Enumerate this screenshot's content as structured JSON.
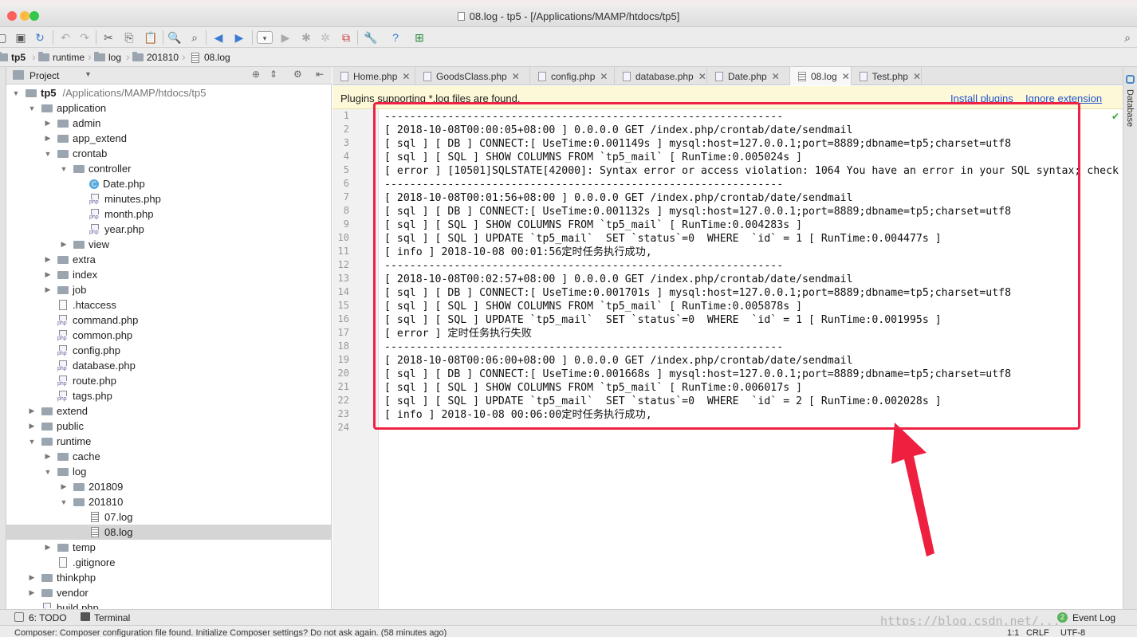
{
  "window": {
    "title": "08.log - tp5 - [/Applications/MAMP/htdocs/tp5]"
  },
  "breadcrumb": [
    "tp5",
    "runtime",
    "log",
    "201810",
    "08.log"
  ],
  "project_panel": {
    "label": "Project",
    "tree": [
      {
        "label": "tp5",
        "path": "/Applications/MAMP/htdocs/tp5",
        "depth": 0,
        "icon": "folder-icon",
        "arrow": "down",
        "bold": true
      },
      {
        "label": "application",
        "depth": 1,
        "icon": "folder-icon",
        "arrow": "down"
      },
      {
        "label": "admin",
        "depth": 2,
        "icon": "folder-icon",
        "arrow": "right"
      },
      {
        "label": "app_extend",
        "depth": 2,
        "icon": "folder-icon",
        "arrow": "right"
      },
      {
        "label": "crontab",
        "depth": 2,
        "icon": "folder-icon",
        "arrow": "down"
      },
      {
        "label": "controller",
        "depth": 3,
        "icon": "folder-icon",
        "arrow": "down"
      },
      {
        "label": "Date.php",
        "depth": 4,
        "icon": "class-icon",
        "arrow": ""
      },
      {
        "label": "minutes.php",
        "depth": 4,
        "icon": "php-file-icon",
        "arrow": ""
      },
      {
        "label": "month.php",
        "depth": 4,
        "icon": "php-file-icon",
        "arrow": ""
      },
      {
        "label": "year.php",
        "depth": 4,
        "icon": "php-file-icon",
        "arrow": ""
      },
      {
        "label": "view",
        "depth": 3,
        "icon": "folder-icon",
        "arrow": "right"
      },
      {
        "label": "extra",
        "depth": 2,
        "icon": "folder-icon",
        "arrow": "right"
      },
      {
        "label": "index",
        "depth": 2,
        "icon": "folder-icon",
        "arrow": "right"
      },
      {
        "label": "job",
        "depth": 2,
        "icon": "folder-icon",
        "arrow": "right"
      },
      {
        "label": ".htaccess",
        "depth": 2,
        "icon": "file-icon",
        "arrow": ""
      },
      {
        "label": "command.php",
        "depth": 2,
        "icon": "php-file-icon",
        "arrow": ""
      },
      {
        "label": "common.php",
        "depth": 2,
        "icon": "php-file-icon",
        "arrow": ""
      },
      {
        "label": "config.php",
        "depth": 2,
        "icon": "php-file-icon",
        "arrow": ""
      },
      {
        "label": "database.php",
        "depth": 2,
        "icon": "php-file-icon",
        "arrow": ""
      },
      {
        "label": "route.php",
        "depth": 2,
        "icon": "php-file-icon",
        "arrow": ""
      },
      {
        "label": "tags.php",
        "depth": 2,
        "icon": "php-file-icon",
        "arrow": ""
      },
      {
        "label": "extend",
        "depth": 1,
        "icon": "folder-icon",
        "arrow": "right"
      },
      {
        "label": "public",
        "depth": 1,
        "icon": "folder-icon",
        "arrow": "right"
      },
      {
        "label": "runtime",
        "depth": 1,
        "icon": "folder-icon",
        "arrow": "down"
      },
      {
        "label": "cache",
        "depth": 2,
        "icon": "folder-icon",
        "arrow": "right"
      },
      {
        "label": "log",
        "depth": 2,
        "icon": "folder-icon",
        "arrow": "down"
      },
      {
        "label": "201809",
        "depth": 3,
        "icon": "folder-icon",
        "arrow": "right"
      },
      {
        "label": "201810",
        "depth": 3,
        "icon": "folder-icon",
        "arrow": "down"
      },
      {
        "label": "07.log",
        "depth": 4,
        "icon": "log-file-icon",
        "arrow": ""
      },
      {
        "label": "08.log",
        "depth": 4,
        "icon": "log-file-icon",
        "arrow": "",
        "selected": true
      },
      {
        "label": "temp",
        "depth": 2,
        "icon": "folder-icon",
        "arrow": "right"
      },
      {
        "label": ".gitignore",
        "depth": 2,
        "icon": "file-icon",
        "arrow": ""
      },
      {
        "label": "thinkphp",
        "depth": 1,
        "icon": "folder-icon",
        "arrow": "right"
      },
      {
        "label": "vendor",
        "depth": 1,
        "icon": "folder-icon",
        "arrow": "right"
      },
      {
        "label": "build.php",
        "depth": 1,
        "icon": "php-file-icon",
        "arrow": ""
      }
    ]
  },
  "editor_tabs": [
    {
      "label": "Home.php",
      "active": false
    },
    {
      "label": "GoodsClass.php",
      "active": false
    },
    {
      "label": "config.php",
      "active": false
    },
    {
      "label": "database.php",
      "active": false
    },
    {
      "label": "Date.php",
      "active": false
    },
    {
      "label": "08.log",
      "active": true
    },
    {
      "label": "Test.php",
      "active": false
    }
  ],
  "banner": {
    "message": "Plugins supporting *.log files are found.",
    "install_link": "Install plugins",
    "ignore_link": "Ignore extension"
  },
  "code_lines": [
    "---------------------------------------------------------------",
    "[ 2018-10-08T00:00:05+08:00 ] 0.0.0.0 GET /index.php/crontab/date/sendmail",
    "[ sql ] [ DB ] CONNECT:[ UseTime:0.001149s ] mysql:host=127.0.0.1;port=8889;dbname=tp5;charset=utf8",
    "[ sql ] [ SQL ] SHOW COLUMNS FROM `tp5_mail` [ RunTime:0.005024s ]",
    "[ error ] [10501]SQLSTATE[42000]: Syntax error or access violation: 1064 You have an error in your SQL syntax; check",
    "---------------------------------------------------------------",
    "[ 2018-10-08T00:01:56+08:00 ] 0.0.0.0 GET /index.php/crontab/date/sendmail",
    "[ sql ] [ DB ] CONNECT:[ UseTime:0.001132s ] mysql:host=127.0.0.1;port=8889;dbname=tp5;charset=utf8",
    "[ sql ] [ SQL ] SHOW COLUMNS FROM `tp5_mail` [ RunTime:0.004283s ]",
    "[ sql ] [ SQL ] UPDATE `tp5_mail`  SET `status`=0  WHERE  `id` = 1 [ RunTime:0.004477s ]",
    "[ info ] 2018-10-08 00:01:56定时任务执行成功,",
    "---------------------------------------------------------------",
    "[ 2018-10-08T00:02:57+08:00 ] 0.0.0.0 GET /index.php/crontab/date/sendmail",
    "[ sql ] [ DB ] CONNECT:[ UseTime:0.001701s ] mysql:host=127.0.0.1;port=8889;dbname=tp5;charset=utf8",
    "[ sql ] [ SQL ] SHOW COLUMNS FROM `tp5_mail` [ RunTime:0.005878s ]",
    "[ sql ] [ SQL ] UPDATE `tp5_mail`  SET `status`=0  WHERE  `id` = 1 [ RunTime:0.001995s ]",
    "[ error ] 定时任务执行失败",
    "---------------------------------------------------------------",
    "[ 2018-10-08T00:06:00+08:00 ] 0.0.0.0 GET /index.php/crontab/date/sendmail",
    "[ sql ] [ DB ] CONNECT:[ UseTime:0.001668s ] mysql:host=127.0.0.1;port=8889;dbname=tp5;charset=utf8",
    "[ sql ] [ SQL ] SHOW COLUMNS FROM `tp5_mail` [ RunTime:0.006017s ]",
    "[ sql ] [ SQL ] UPDATE `tp5_mail`  SET `status`=0  WHERE  `id` = 2 [ RunTime:0.002028s ]",
    "[ info ] 2018-10-08 00:06:00定时任务执行成功,",
    ""
  ],
  "right_panel": {
    "label": "Database"
  },
  "bottom_tools": {
    "todo": "6: TODO",
    "terminal": "Terminal",
    "event_log_count": "2",
    "event_log": "Event Log"
  },
  "status_bar": {
    "message": "Composer: Composer configuration file found. Initialize Composer settings? Do not ask again. (58 minutes ago)",
    "position": "1:1",
    "line_sep": "CRLF",
    "encoding": "UTF-8"
  },
  "watermark": "https://blog.csdn.net/...",
  "colors": {
    "highlight_box": "#ee2244",
    "arrow": "#ee1f3f",
    "link": "#2255cc",
    "banner_bg": "#fdf8d8"
  }
}
